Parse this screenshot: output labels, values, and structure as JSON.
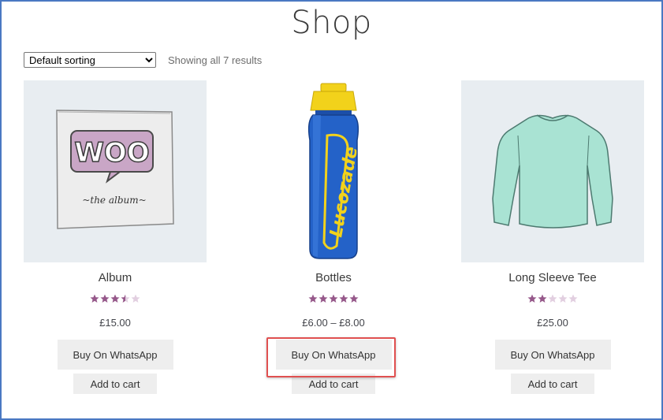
{
  "page": {
    "title": "Shop"
  },
  "toolbar": {
    "sort_selected": "Default sorting",
    "sort_options": [
      "Default sorting"
    ],
    "result_count": "Showing all 7 results"
  },
  "products": [
    {
      "title": "Album",
      "rating": 3.5,
      "price": "£15.00",
      "whatsapp_label": "Buy On WhatsApp",
      "cart_label": "Add to cart"
    },
    {
      "title": "Bottles",
      "rating": 5,
      "price": "£6.00 – £8.00",
      "whatsapp_label": "Buy On WhatsApp",
      "cart_label": "Add to cart"
    },
    {
      "title": "Long Sleeve Tee",
      "rating": 2,
      "price": "£25.00",
      "whatsapp_label": "Buy On WhatsApp",
      "cart_label": "Add to cart"
    }
  ],
  "colors": {
    "star_filled": "#96588a",
    "star_empty": "#e2cfe0",
    "highlight_border": "#e05050",
    "frame_border": "#4a78c2",
    "button_bg": "#eeeeee"
  },
  "images": {
    "album_text_1": "WOO",
    "album_text_2": "~the album~",
    "bottle_text": "Lucozade"
  }
}
